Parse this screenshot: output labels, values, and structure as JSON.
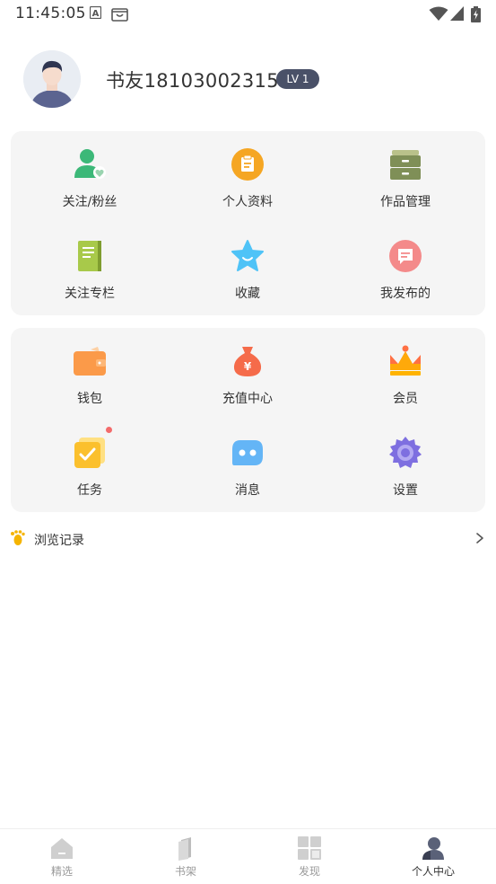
{
  "status_bar": {
    "time": "11:45:05"
  },
  "profile": {
    "username": "书友18103002315",
    "level": "LV 1"
  },
  "card1": {
    "items": [
      {
        "label": "关注/粉丝",
        "icon": "follow-fans-icon",
        "color": "#3cb878"
      },
      {
        "label": "个人资料",
        "icon": "profile-info-icon",
        "color": "#f5a623"
      },
      {
        "label": "作品管理",
        "icon": "works-manage-icon",
        "color": "#8a9a5b"
      },
      {
        "label": "关注专栏",
        "icon": "column-book-icon",
        "color": "#a8c94a"
      },
      {
        "label": "收藏",
        "icon": "star-icon",
        "color": "#4fc3f7"
      },
      {
        "label": "我发布的",
        "icon": "my-posts-icon",
        "color": "#f48a8a"
      }
    ]
  },
  "card2": {
    "items": [
      {
        "label": "钱包",
        "icon": "wallet-icon",
        "color": "#fb9a49"
      },
      {
        "label": "充值中心",
        "icon": "money-bag-icon",
        "color": "#f56b4a"
      },
      {
        "label": "会员",
        "icon": "crown-icon",
        "color": "#ff7043"
      },
      {
        "label": "任务",
        "icon": "task-icon",
        "color": "#fbc02d"
      },
      {
        "label": "消息",
        "icon": "message-icon",
        "color": "#64b5f6"
      },
      {
        "label": "设置",
        "icon": "gear-icon",
        "color": "#7e6fe0"
      }
    ]
  },
  "history": {
    "label": "浏览记录",
    "icon": "footprint-icon"
  },
  "tabs": [
    {
      "label": "精选",
      "icon": "home-icon"
    },
    {
      "label": "书架",
      "icon": "bookshelf-icon"
    },
    {
      "label": "发现",
      "icon": "discover-icon"
    },
    {
      "label": "个人中心",
      "icon": "user-center-icon"
    }
  ]
}
